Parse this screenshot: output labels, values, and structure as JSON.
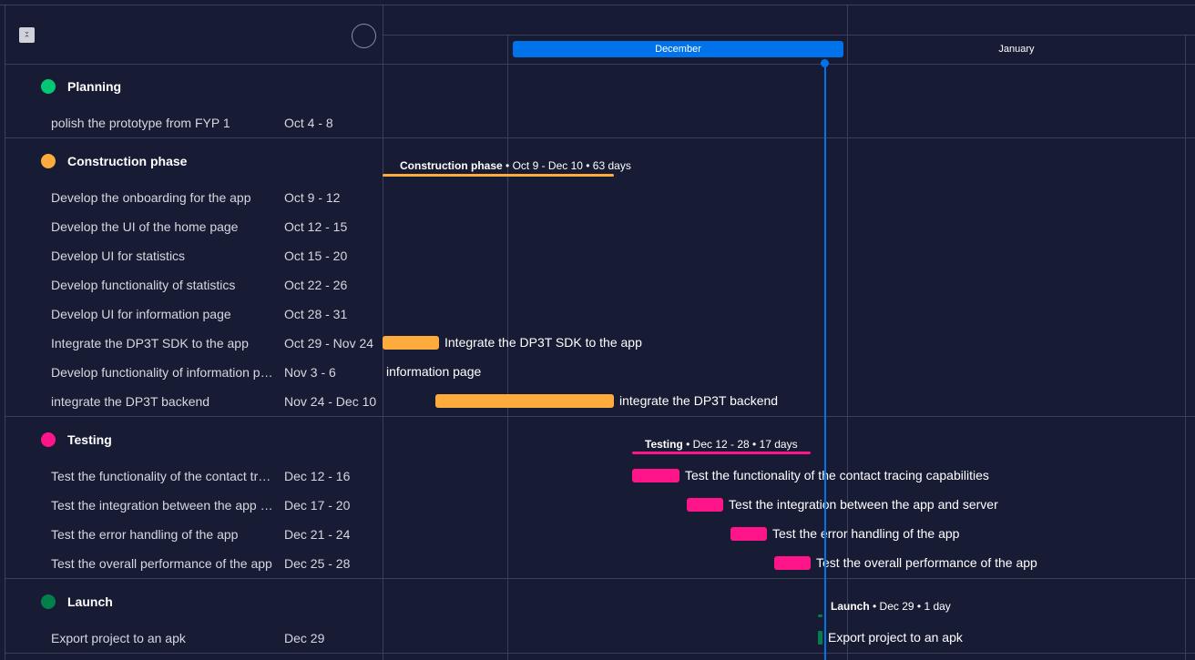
{
  "header": {
    "months": [
      "December",
      "January"
    ]
  },
  "groups": [
    {
      "title": "Planning",
      "color": "#00c875",
      "tasks": [
        {
          "name": "polish the prototype from FYP 1",
          "dates": "Oct 4 - 8"
        }
      ]
    },
    {
      "title": "Construction phase",
      "color": "#fdab3d",
      "summary": {
        "name": "Construction phase",
        "details": "• Oct 9 - Dec 10 • 63 days"
      },
      "tasks": [
        {
          "name": "Develop the onboarding for the app",
          "dates": "Oct 9 - 12"
        },
        {
          "name": "Develop the UI of the home page",
          "dates": "Oct 12 - 15"
        },
        {
          "name": "Develop UI for statistics",
          "dates": "Oct 15 - 20"
        },
        {
          "name": "Develop functionality of statistics",
          "dates": "Oct 22 - 26"
        },
        {
          "name": "Develop UI for information page",
          "dates": "Oct 28 - 31"
        },
        {
          "name": "Integrate the DP3T SDK to the app",
          "dates": "Oct 29 - Nov 24",
          "bar_label": "Integrate the DP3T SDK to the app"
        },
        {
          "name": "Develop functionality of information page",
          "dates": "Nov 3 - 6",
          "bar_label": "information page"
        },
        {
          "name": "integrate the DP3T backend",
          "dates": "Nov 24 - Dec 10",
          "bar_label": "integrate the DP3T backend"
        }
      ]
    },
    {
      "title": "Testing",
      "color": "#ff158a",
      "summary": {
        "name": "Testing",
        "details": "• Dec 12 - 28 • 17 days"
      },
      "tasks": [
        {
          "name": "Test the functionality of the contact tracing capabilities",
          "dates": "Dec 12 - 16",
          "bar_label": "Test the functionality of the contact tracing capabilities"
        },
        {
          "name": "Test the integration between the app and server",
          "dates": "Dec 17 - 20",
          "bar_label": "Test the integration between the app and server"
        },
        {
          "name": "Test the error handling of the app",
          "dates": "Dec 21 - 24",
          "bar_label": "Test the error handling of the app"
        },
        {
          "name": "Test the overall performance of the app",
          "dates": "Dec 25 - 28",
          "bar_label": "Test the overall performance of the app"
        }
      ]
    },
    {
      "title": "Launch",
      "color": "#037f4c",
      "summary": {
        "name": "Launch",
        "details": "• Dec 29 • 1 day"
      },
      "tasks": [
        {
          "name": "Export project to an apk",
          "dates": "Dec 29",
          "bar_label": "Export project to an apk"
        }
      ]
    }
  ]
}
